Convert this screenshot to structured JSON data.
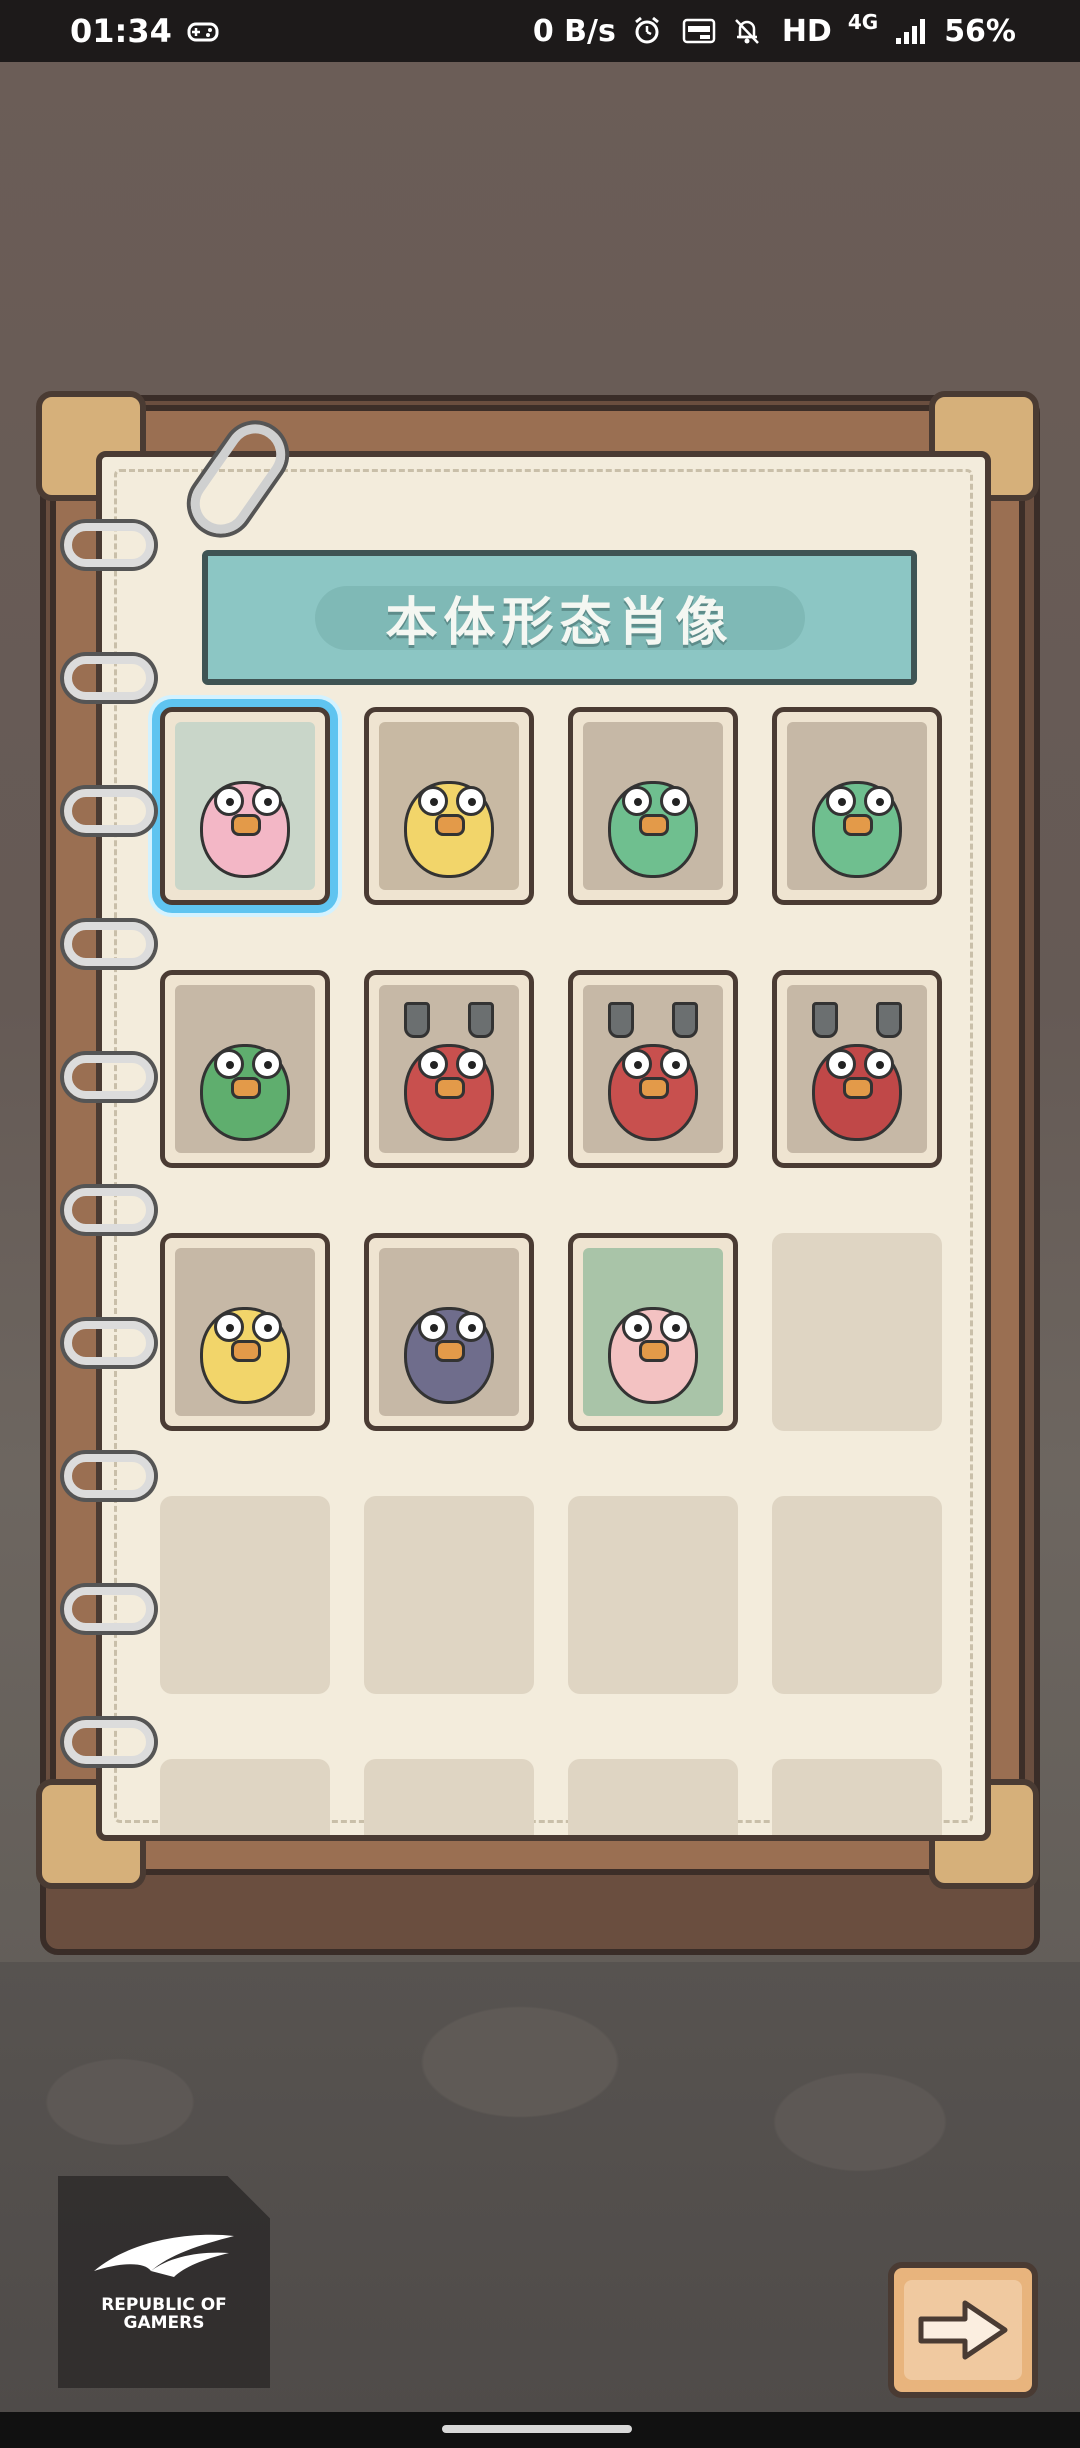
{
  "status_bar": {
    "time": "01:34",
    "net_speed": "0 B/s",
    "hd": "HD",
    "network": "4G",
    "battery": "56%"
  },
  "codex": {
    "title": "本体形态肖像",
    "portraits": [
      {
        "name": "pink-snail",
        "unlocked": true,
        "selected": true,
        "colors": {
          "bg": "#c9d6c9",
          "body": "#f3b7c6"
        }
      },
      {
        "name": "yellow-snail-chick",
        "unlocked": true,
        "selected": false,
        "colors": {
          "bg": "#c8b9a3",
          "body": "#f2d56a"
        }
      },
      {
        "name": "green-spotted-bird",
        "unlocked": true,
        "selected": false,
        "colors": {
          "bg": "#c6b8a6",
          "body": "#6fbf8f"
        }
      },
      {
        "name": "green-brain-bird",
        "unlocked": true,
        "selected": false,
        "colors": {
          "bg": "#c6b8a6",
          "body": "#6fbf8f"
        }
      },
      {
        "name": "green-one-eye-bird",
        "unlocked": true,
        "selected": false,
        "colors": {
          "bg": "#c6b8a6",
          "body": "#5fae6e"
        }
      },
      {
        "name": "red-cat-bird",
        "unlocked": true,
        "selected": false,
        "colors": {
          "bg": "#c6b8a6",
          "body": "#c8504e"
        }
      },
      {
        "name": "red-horned-bird",
        "unlocked": true,
        "selected": false,
        "colors": {
          "bg": "#c6b8a6",
          "body": "#c8504e"
        }
      },
      {
        "name": "red-demon-bird",
        "unlocked": true,
        "selected": false,
        "colors": {
          "bg": "#c6b8a6",
          "body": "#c04848"
        }
      },
      {
        "name": "yellow-chick",
        "unlocked": true,
        "selected": false,
        "colors": {
          "bg": "#c6b8a6",
          "body": "#f2d56a"
        }
      },
      {
        "name": "purple-mole",
        "unlocked": true,
        "selected": false,
        "colors": {
          "bg": "#c6b8a6",
          "body": "#6f6d8c"
        }
      },
      {
        "name": "pink-snail-vendor",
        "unlocked": true,
        "selected": false,
        "colors": {
          "bg": "#a9c4a8",
          "body": "#f3c2c2"
        }
      },
      {
        "name": "locked",
        "unlocked": false
      },
      {
        "name": "locked",
        "unlocked": false
      },
      {
        "name": "locked",
        "unlocked": false
      },
      {
        "name": "locked",
        "unlocked": false
      },
      {
        "name": "locked",
        "unlocked": false
      },
      {
        "name": "locked",
        "unlocked": false
      },
      {
        "name": "locked",
        "unlocked": false
      },
      {
        "name": "locked",
        "unlocked": false
      },
      {
        "name": "locked",
        "unlocked": false
      }
    ]
  },
  "branding": {
    "logo_line1": "REPUBLIC OF",
    "logo_line2": "GAMERS"
  },
  "icons": {
    "gamepad": "gamepad-icon",
    "alarm": "alarm-icon",
    "auto_hz": "auto-hz-icon",
    "mute": "notifications-off-icon",
    "signal": "signal-icon",
    "next": "arrow-right-icon"
  }
}
